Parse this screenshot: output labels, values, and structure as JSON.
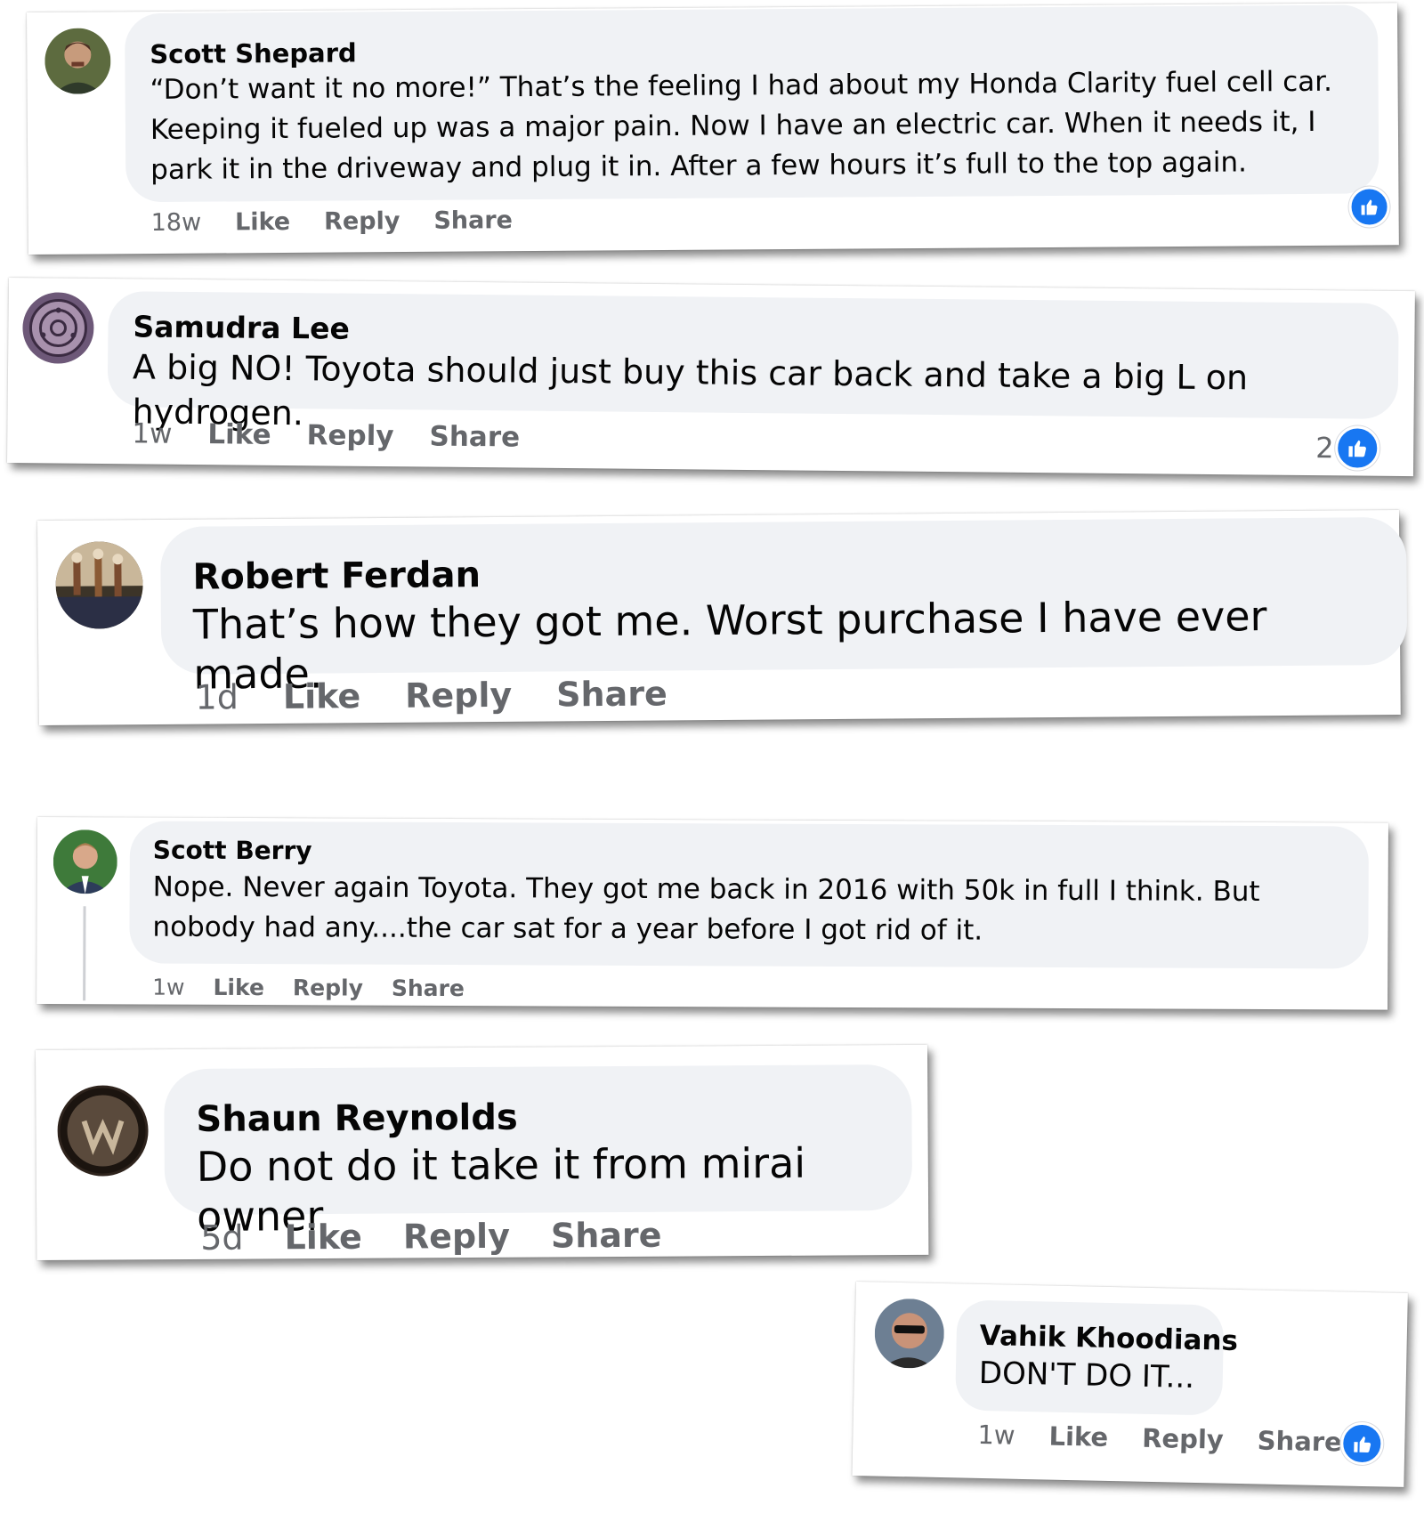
{
  "colors": {
    "bubble": "#f0f2f5",
    "secondary_text": "#65676b",
    "like_blue": "#1877f2"
  },
  "comments": [
    {
      "author": "Scott Shepard",
      "text": "“Don’t want it no more!” That’s the feeling I had about my Honda Clarity fuel cell car. Keeping it fueled up was a major pain. Now I have an electric car. When it needs it, I park it in the driveway and plug it in. After a few hours it’s full to the top again.",
      "time": "18w",
      "like_label": "Like",
      "reply_label": "Reply",
      "share_label": "Share",
      "reaction_icon": "like-icon"
    },
    {
      "author": "Samudra Lee",
      "text": "A big NO! Toyota should just buy this car back and take a big L on hydrogen.",
      "time": "1w",
      "like_label": "Like",
      "reply_label": "Reply",
      "share_label": "Share",
      "reaction_count": "2",
      "reaction_icon": "like-icon"
    },
    {
      "author": "Robert Ferdan",
      "text": "That’s how they got me. Worst purchase I have ever made.",
      "time": "1d",
      "like_label": "Like",
      "reply_label": "Reply",
      "share_label": "Share"
    },
    {
      "author": "Scott Berry",
      "text": "Nope. Never again Toyota. They got me back in 2016 with 50k in full I think. But nobody had any....the car sat for a year before I got rid of it.",
      "time": "1w",
      "like_label": "Like",
      "reply_label": "Reply",
      "share_label": "Share"
    },
    {
      "author": "Shaun Reynolds",
      "text": "Do not do it take it from mirai owner",
      "time": "5d",
      "like_label": "Like",
      "reply_label": "Reply",
      "share_label": "Share"
    },
    {
      "author": "Vahik Khoodians",
      "text": "DON'T DO IT...",
      "time": "1w",
      "like_label": "Like",
      "reply_label": "Reply",
      "share_label": "Share",
      "reaction_icon": "like-icon"
    }
  ]
}
